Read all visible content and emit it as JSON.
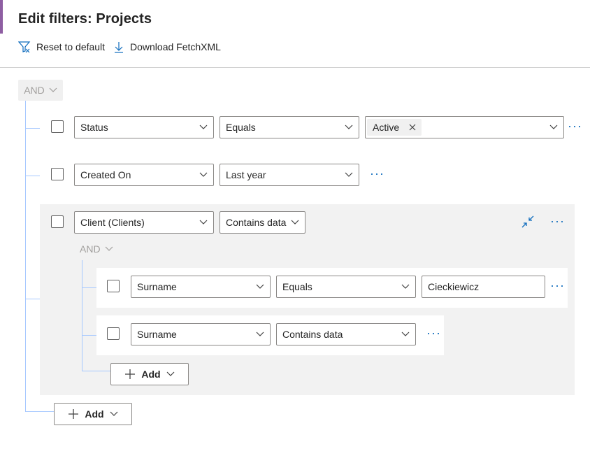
{
  "header": {
    "title": "Edit filters: Projects",
    "reset_label": "Reset to default",
    "download_label": "Download FetchXML"
  },
  "root": {
    "operator": "AND",
    "rows": [
      {
        "field": "Status",
        "condition": "Equals",
        "value_tag": "Active"
      },
      {
        "field": "Created On",
        "condition": "Last year"
      }
    ],
    "group": {
      "field": "Client (Clients)",
      "condition": "Contains data",
      "operator": "AND",
      "rows": [
        {
          "field": "Surname",
          "condition": "Equals",
          "value": "Cieckiewicz"
        },
        {
          "field": "Surname",
          "condition": "Contains data"
        }
      ],
      "add_label": "Add"
    },
    "add_label": "Add"
  },
  "icons": {
    "reset": "filter-reset-icon",
    "download": "download-arrow-icon",
    "collapse": "collapse-arrows-icon",
    "chevron": "chevron-down-icon",
    "more": "more-ellipsis-icon",
    "add": "plus-icon",
    "remove": "close-icon"
  },
  "colors": {
    "accent": "#0f6cbd",
    "tree_line": "#a6c8ff",
    "group_bg": "#f2f2f2"
  }
}
